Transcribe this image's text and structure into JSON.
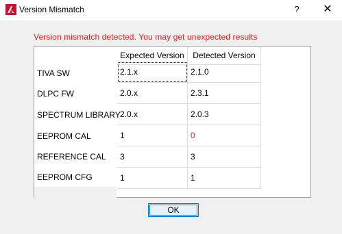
{
  "window": {
    "title": "Version Mismatch",
    "help_label": "?",
    "close_label": "✕"
  },
  "warning": "Version mismatch detected. You may get unexpected results",
  "table": {
    "headers": [
      "Expected Version",
      "Detected Version"
    ],
    "rows": [
      {
        "label": "TIVA SW",
        "expected": "2.1.x",
        "detected": "2.1.0"
      },
      {
        "label": "DLPC FW",
        "expected": "2.0.x",
        "detected": "2.3.1"
      },
      {
        "label": "SPECTRUM LIBRARY",
        "expected": "2.0.x",
        "detected": "2.0.3"
      },
      {
        "label": "EEPROM CAL",
        "expected": "1",
        "detected": "0"
      },
      {
        "label": "REFERENCE CAL",
        "expected": "3",
        "detected": "3"
      },
      {
        "label": "EEPROM CFG",
        "expected": "1",
        "detected": "1"
      }
    ]
  },
  "ok_label": "OK",
  "colors": {
    "warning": "#e0201c",
    "mismatch_value": "#e0201c",
    "ok_border": "#0078d7"
  }
}
